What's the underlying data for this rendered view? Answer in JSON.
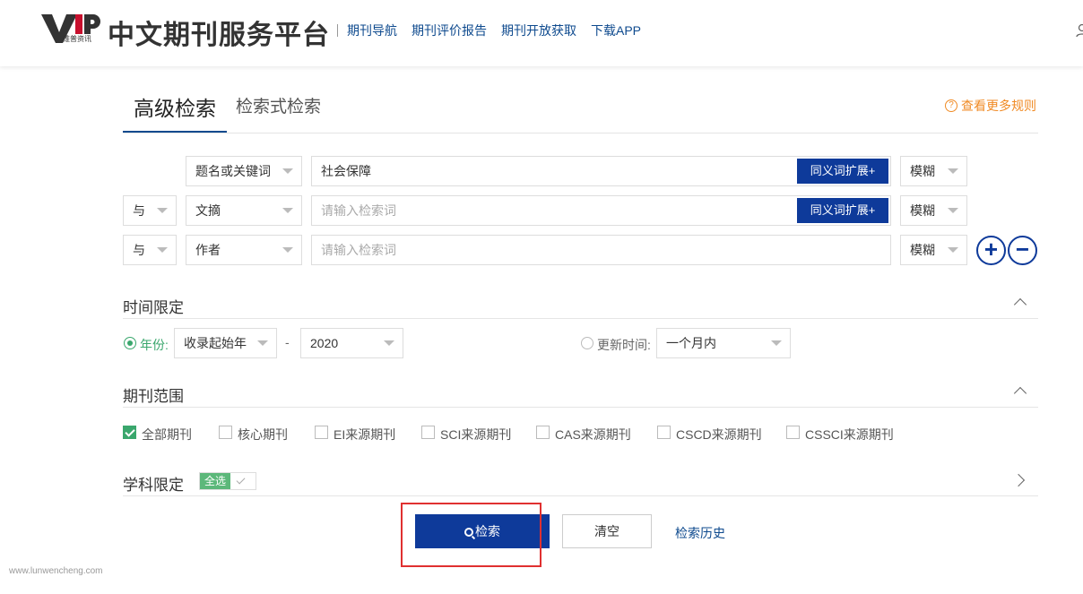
{
  "header": {
    "logo_text": "VIP",
    "logo_sub": "维普资讯",
    "site_title": "中文期刊服务平台",
    "nav": [
      "期刊导航",
      "期刊评价报告",
      "期刊开放获取",
      "下载APP"
    ]
  },
  "tabs": {
    "active": "高级检索",
    "other": "检索式检索",
    "more_rules": "查看更多规则",
    "more_rules_icon": "?"
  },
  "rows": [
    {
      "logic": "",
      "field": "题名或关键词",
      "value": "社会保障",
      "placeholder": "",
      "synonym": "同义词扩展+",
      "match": "模糊"
    },
    {
      "logic": "与",
      "field": "文摘",
      "value": "",
      "placeholder": "请输入检索词",
      "synonym": "同义词扩展+",
      "match": "模糊"
    },
    {
      "logic": "与",
      "field": "作者",
      "value": "",
      "placeholder": "请输入检索词",
      "synonym": "",
      "match": "模糊"
    }
  ],
  "add_button": "+",
  "remove_button": "−",
  "time": {
    "title": "时间限定",
    "year_label": "年份:",
    "year_start": "收录起始年",
    "dash": "-",
    "year_end": "2020",
    "update_label": "更新时间:",
    "update_value": "一个月内"
  },
  "journal": {
    "title": "期刊范围",
    "options": [
      {
        "label": "全部期刊",
        "checked": true
      },
      {
        "label": "核心期刊",
        "checked": false
      },
      {
        "label": "EI来源期刊",
        "checked": false
      },
      {
        "label": "SCI来源期刊",
        "checked": false
      },
      {
        "label": "CAS来源期刊",
        "checked": false
      },
      {
        "label": "CSCD来源期刊",
        "checked": false
      },
      {
        "label": "CSSCI来源期刊",
        "checked": false
      }
    ]
  },
  "subject": {
    "title": "学科限定",
    "all_label": "全选"
  },
  "actions": {
    "search": "检索",
    "clear": "清空",
    "history": "检索历史"
  },
  "watermark": "www.lunwencheng.com",
  "colors": {
    "primary": "#0e3a9a",
    "link": "#0e4a8e",
    "accent": "#f08a24",
    "check_green": "#3aa76d",
    "highlight": "#e03030"
  }
}
